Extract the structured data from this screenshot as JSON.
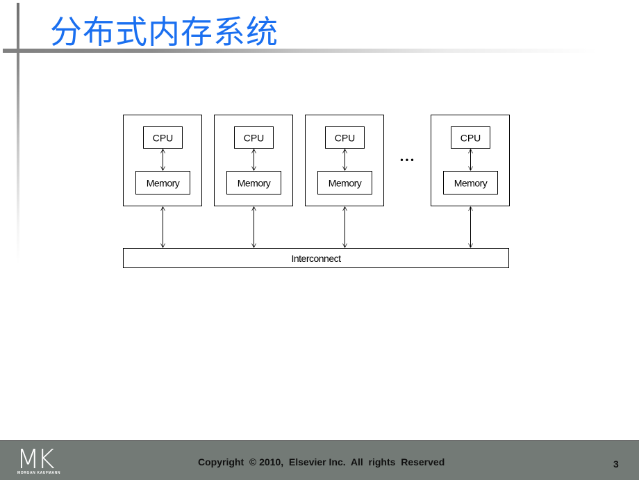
{
  "slide": {
    "title": "分布式内存系统",
    "page_number": "3",
    "accent_color": "#1a6ff0"
  },
  "diagram": {
    "nodes": [
      {
        "cpu_label": "CPU",
        "memory_label": "Memory"
      },
      {
        "cpu_label": "CPU",
        "memory_label": "Memory"
      },
      {
        "cpu_label": "CPU",
        "memory_label": "Memory"
      },
      {
        "cpu_label": "CPU",
        "memory_label": "Memory"
      }
    ],
    "ellipsis": "• • •",
    "interconnect_label": "Interconnect"
  },
  "footer": {
    "logo_text": "MK",
    "logo_subtext": "MORGAN KAUFMANN",
    "copyright": "Copyright  © 2010,  Elsevier Inc.  All  rights  Reserved",
    "background_color": "#737a76"
  }
}
